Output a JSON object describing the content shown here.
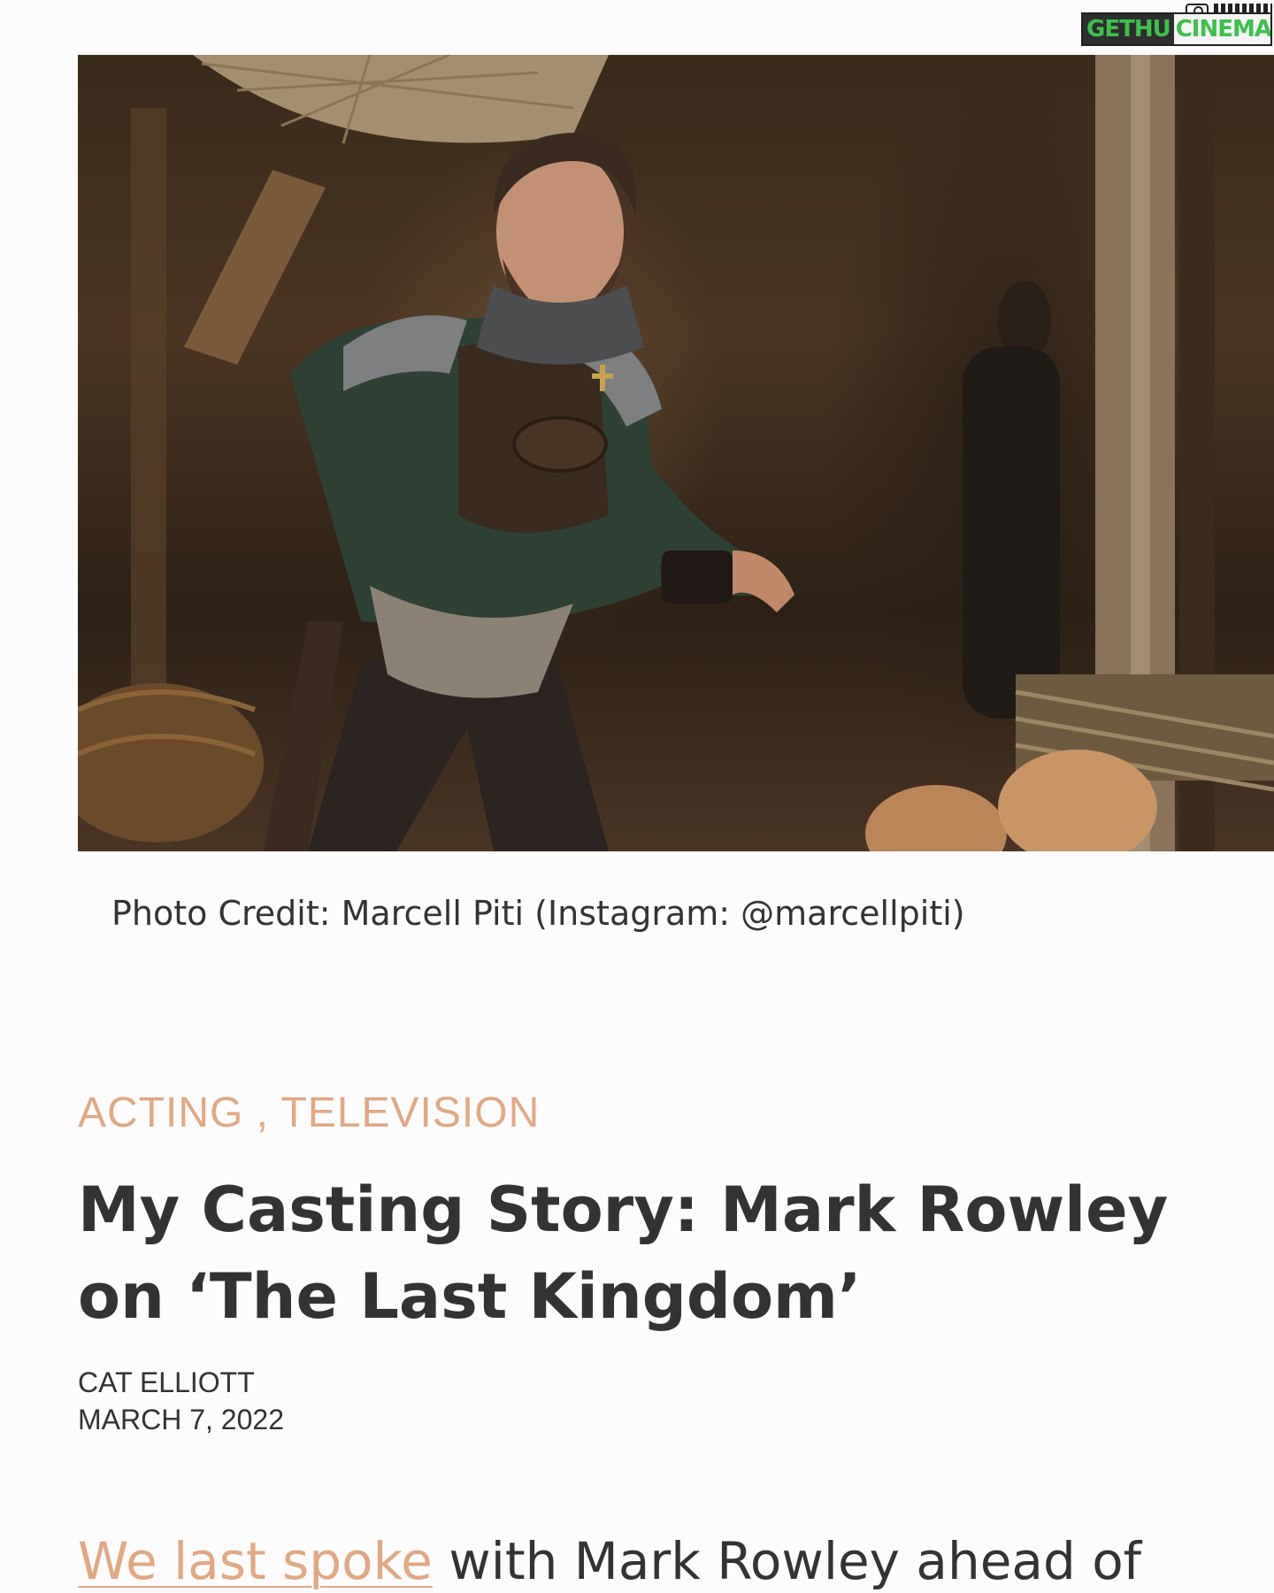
{
  "watermark": {
    "left": "GETHU",
    "right": "CINEMA",
    "icon": "camera-icon"
  },
  "hero_image": {
    "alt": "Man in chainmail armor crouching in a rustic wooden hut",
    "caption": "Photo Credit: Marcell Piti (Instagram: @marcellpiti)"
  },
  "article": {
    "category_1": "ACTING",
    "category_sep": " , ",
    "category_2": "TELEVISION",
    "title": "My Casting Story: Mark Rowley on ‘The Last Kingdom’",
    "author": "CAT ELLIOTT",
    "date": "MARCH 7, 2022",
    "lead_link": "We last spoke",
    "lead_rest": " with Mark Rowley ahead of"
  },
  "colors": {
    "accent": "#e0a883",
    "text": "#333333",
    "logo_green": "#3cc14a"
  }
}
